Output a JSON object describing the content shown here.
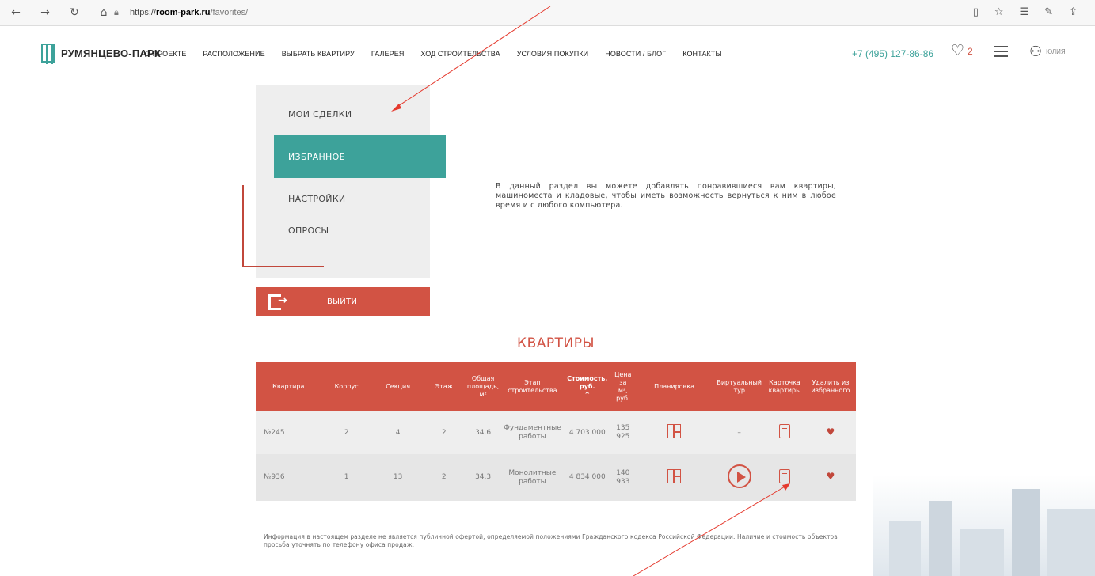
{
  "browser": {
    "url_host": "room-park.ru",
    "url_prefix": "https://",
    "url_path": "/favorites/"
  },
  "header": {
    "logo_text": "РУМЯНЦЕВО-ПАРК",
    "menu": [
      "О ПРОЕКТЕ",
      "РАСПОЛОЖЕНИЕ",
      "ВЫБРАТЬ КВАРТИРУ",
      "ГАЛЕРЕЯ",
      "ХОД СТРОИТЕЛЬСТВА",
      "УСЛОВИЯ ПОКУПКИ",
      "НОВОСТИ / БЛОГ",
      "КОНТАКТЫ"
    ],
    "phone": "+7 (495) 127-86-86",
    "favorites_count": "2",
    "user_name": "ЮЛИЯ"
  },
  "sidebar": {
    "items": [
      "МОИ СДЕЛКИ",
      "ИЗБРАННОЕ",
      "НАСТРОЙКИ",
      "ОПРОСЫ"
    ],
    "logout": "ВЫЙТИ"
  },
  "intro_text": "В данный раздел вы можете добавлять понравившиеся вам квартиры, машиноместа и кладовые, чтобы иметь возможность вернуться к ним в любое время и с любого компьютера.",
  "section_title": "КВАРТИРЫ",
  "table": {
    "headers": [
      "Квартира",
      "Корпус",
      "Секция",
      "Этаж",
      "Общая площадь, м²",
      "Этап строительства",
      "Стоимость, руб.",
      "Цена за м², руб.",
      "Планировка",
      "Виртуальный тур",
      "Карточка квартиры",
      "Удалить из избранного"
    ],
    "sort_indicator": "^",
    "rows": [
      {
        "apt": "№245",
        "building": "2",
        "section": "4",
        "floor": "2",
        "area": "34.6",
        "stage": "Фундаментные работы",
        "price": "4 703 000",
        "price_m2": "135 925",
        "tour": "–"
      },
      {
        "apt": "№936",
        "building": "1",
        "section": "13",
        "floor": "2",
        "area": "34.3",
        "stage": "Монолитные работы",
        "price": "4 834 000",
        "price_m2": "140 933",
        "tour": ""
      }
    ]
  },
  "disclaimer": "Информация в настоящем разделе не является публичной офертой, определяемой положениями Гражданского кодекса Российской Федерации. Наличие и стоимость объектов просьба уточнять по телефону офиса продаж.",
  "colors": {
    "accent": "#3da29a",
    "brand_red": "#d25344",
    "panel": "#eeeeee"
  }
}
